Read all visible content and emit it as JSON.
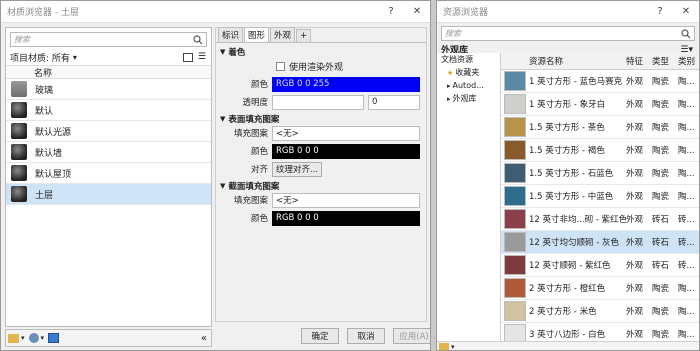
{
  "material_browser": {
    "title": "材质浏览器 - 土层",
    "help_btn": "?",
    "close_btn": "✕",
    "search_placeholder": "搜索",
    "filter_label": "项目材质: 所有",
    "col_name": "名称",
    "materials": [
      {
        "name": "玻璃",
        "kind": "glass"
      },
      {
        "name": "默认",
        "kind": "sphere"
      },
      {
        "name": "默认光源",
        "kind": "sphere"
      },
      {
        "name": "默认墙",
        "kind": "sphere"
      },
      {
        "name": "默认屋顶",
        "kind": "sphere"
      },
      {
        "name": "土层",
        "kind": "sphere",
        "selected": true
      }
    ],
    "tabs": [
      "标识",
      "图形",
      "外观",
      "+"
    ],
    "active_tab": "图形",
    "shading": {
      "title": "着色",
      "use_render": "使用渲染外观",
      "color_label": "颜色",
      "color_value": "RGB 0 0 255",
      "transparency_label": "透明度",
      "transparency_value": "0"
    },
    "surface": {
      "title": "表面填充图案",
      "pattern_label": "填充图案",
      "pattern_value": "<无>",
      "color_label": "颜色",
      "color_value": "RGB 0 0 0",
      "align_label": "对齐",
      "align_value": "纹理对齐..."
    },
    "cut": {
      "title": "截面填充图案",
      "pattern_label": "填充图案",
      "pattern_value": "<无>",
      "color_label": "颜色",
      "color_value": "RGB 0 0 0"
    },
    "ok": "确定",
    "cancel": "取消",
    "apply": "应用(A)",
    "collapse": "«"
  },
  "asset_browser": {
    "title": "资源浏览器",
    "help_btn": "?",
    "close_btn": "✕",
    "search_placeholder": "搜索",
    "section_title": "外观库",
    "tree": [
      {
        "label": "文档资源",
        "indent": 0
      },
      {
        "label": "收藏夹",
        "indent": 1,
        "icon": "★"
      },
      {
        "label": "Autod...",
        "indent": 1,
        "icon": "▸"
      },
      {
        "label": "外观库",
        "indent": 1,
        "icon": "▸"
      }
    ],
    "col_name": "资源名称",
    "col_feature": "特征",
    "col_type": "类型",
    "col_cat": "类别",
    "rows": [
      {
        "name": "1 英寸方形 - 蓝色马赛克",
        "feature": "外观",
        "type": "陶瓷",
        "cat": "陶...",
        "color": "#5c8aa6"
      },
      {
        "name": "1 英寸方形 - 象牙白",
        "feature": "外观",
        "type": "陶瓷",
        "cat": "陶...",
        "color": "#cfcfcc"
      },
      {
        "name": "1.5 英寸方形 - 茶色",
        "feature": "外观",
        "type": "陶瓷",
        "cat": "陶...",
        "color": "#b8934a"
      },
      {
        "name": "1.5 英寸方形 - 褐色",
        "feature": "外观",
        "type": "陶瓷",
        "cat": "陶...",
        "color": "#8a5a2a"
      },
      {
        "name": "1.5 英寸方形 - 石蓝色",
        "feature": "外观",
        "type": "陶瓷",
        "cat": "陶...",
        "color": "#3f5d72"
      },
      {
        "name": "1.5 英寸方形 - 中蓝色",
        "feature": "外观",
        "type": "陶瓷",
        "cat": "陶...",
        "color": "#2f6d8c"
      },
      {
        "name": "12 英寸非均...砌 - 紫红色",
        "feature": "外观",
        "type": "砖石",
        "cat": "砖...",
        "color": "#8a3f4a"
      },
      {
        "name": "12 英寸均匀顺砌 - 灰色",
        "feature": "外观",
        "type": "砖石",
        "cat": "砖...",
        "color": "#9a9a9a",
        "selected": true
      },
      {
        "name": "12 英寸顺砌 - 紫红色",
        "feature": "外观",
        "type": "砖石",
        "cat": "砖...",
        "color": "#7f3a40"
      },
      {
        "name": "2 英寸方形 - 橙红色",
        "feature": "外观",
        "type": "陶瓷",
        "cat": "陶...",
        "color": "#b05a3a"
      },
      {
        "name": "2 英寸方形 - 米色",
        "feature": "外观",
        "type": "陶瓷",
        "cat": "陶...",
        "color": "#d2c3a0"
      },
      {
        "name": "3 英寸八边形 - 白色",
        "feature": "外观",
        "type": "陶瓷",
        "cat": "陶...",
        "color": "#e5e5e5"
      }
    ]
  }
}
